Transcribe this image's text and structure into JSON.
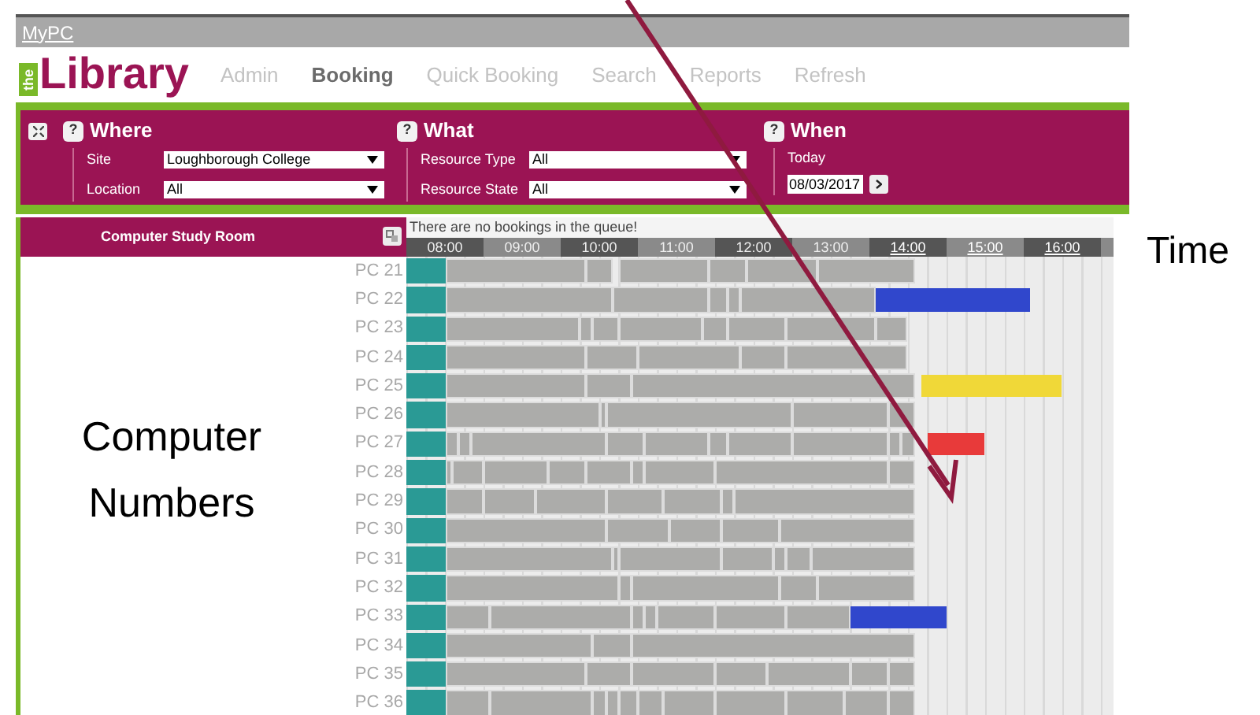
{
  "top_bar": {
    "link": "MyPC"
  },
  "logo": {
    "badge": "the",
    "name": "Library"
  },
  "nav": [
    {
      "label": "Admin",
      "selected": false
    },
    {
      "label": "Booking",
      "selected": true
    },
    {
      "label": "Quick Booking",
      "selected": false
    },
    {
      "label": "Search",
      "selected": false
    },
    {
      "label": "Reports",
      "selected": false
    },
    {
      "label": "Refresh",
      "selected": false
    }
  ],
  "filters": [
    {
      "kind": "fields",
      "help": "?",
      "title": "Where",
      "fields": [
        {
          "label": "Site",
          "value": "Loughborough College"
        },
        {
          "label": "Location",
          "value": "All"
        }
      ]
    },
    {
      "kind": "fields",
      "help": "?",
      "title": "What",
      "fields": [
        {
          "label": "Resource Type",
          "value": "All"
        },
        {
          "label": "Resource State",
          "value": "All"
        }
      ]
    },
    {
      "kind": "date",
      "help": "?",
      "title": "When",
      "label": "Today",
      "date": "08/03/2017"
    }
  ],
  "room": {
    "title": "Computer Study Room"
  },
  "queue_message": "There are no bookings in the queue!",
  "hours": [
    {
      "label": "08:00",
      "link": false
    },
    {
      "label": "09:00",
      "link": false
    },
    {
      "label": "10:00",
      "link": false
    },
    {
      "label": "11:00",
      "link": false
    },
    {
      "label": "12:00",
      "link": false
    },
    {
      "label": "13:00",
      "link": false
    },
    {
      "label": "14:00",
      "link": true
    },
    {
      "label": "15:00",
      "link": true
    },
    {
      "label": "16:00",
      "link": true
    }
  ],
  "computers": [
    {
      "name": "PC 21"
    },
    {
      "name": "PC 22",
      "reservations": [
        {
          "color": "#3047cc"
        }
      ]
    },
    {
      "name": "PC 23"
    },
    {
      "name": "PC 24"
    },
    {
      "name": "PC 25",
      "reservations": [
        {
          "color": "#f0d838"
        }
      ]
    },
    {
      "name": "PC 26"
    },
    {
      "name": "PC 27",
      "reservations": [
        {
          "color": "#e83a3a"
        }
      ]
    },
    {
      "name": "PC 28"
    },
    {
      "name": "PC 29"
    },
    {
      "name": "PC 30"
    },
    {
      "name": "PC 31"
    },
    {
      "name": "PC 32"
    },
    {
      "name": "PC 33",
      "reservations": [
        {
          "color": "#3047cc"
        }
      ]
    },
    {
      "name": "PC 34"
    },
    {
      "name": "PC 35"
    },
    {
      "name": "PC 36"
    }
  ],
  "annotations": {
    "time": "Time",
    "computers": "Computer Numbers"
  }
}
